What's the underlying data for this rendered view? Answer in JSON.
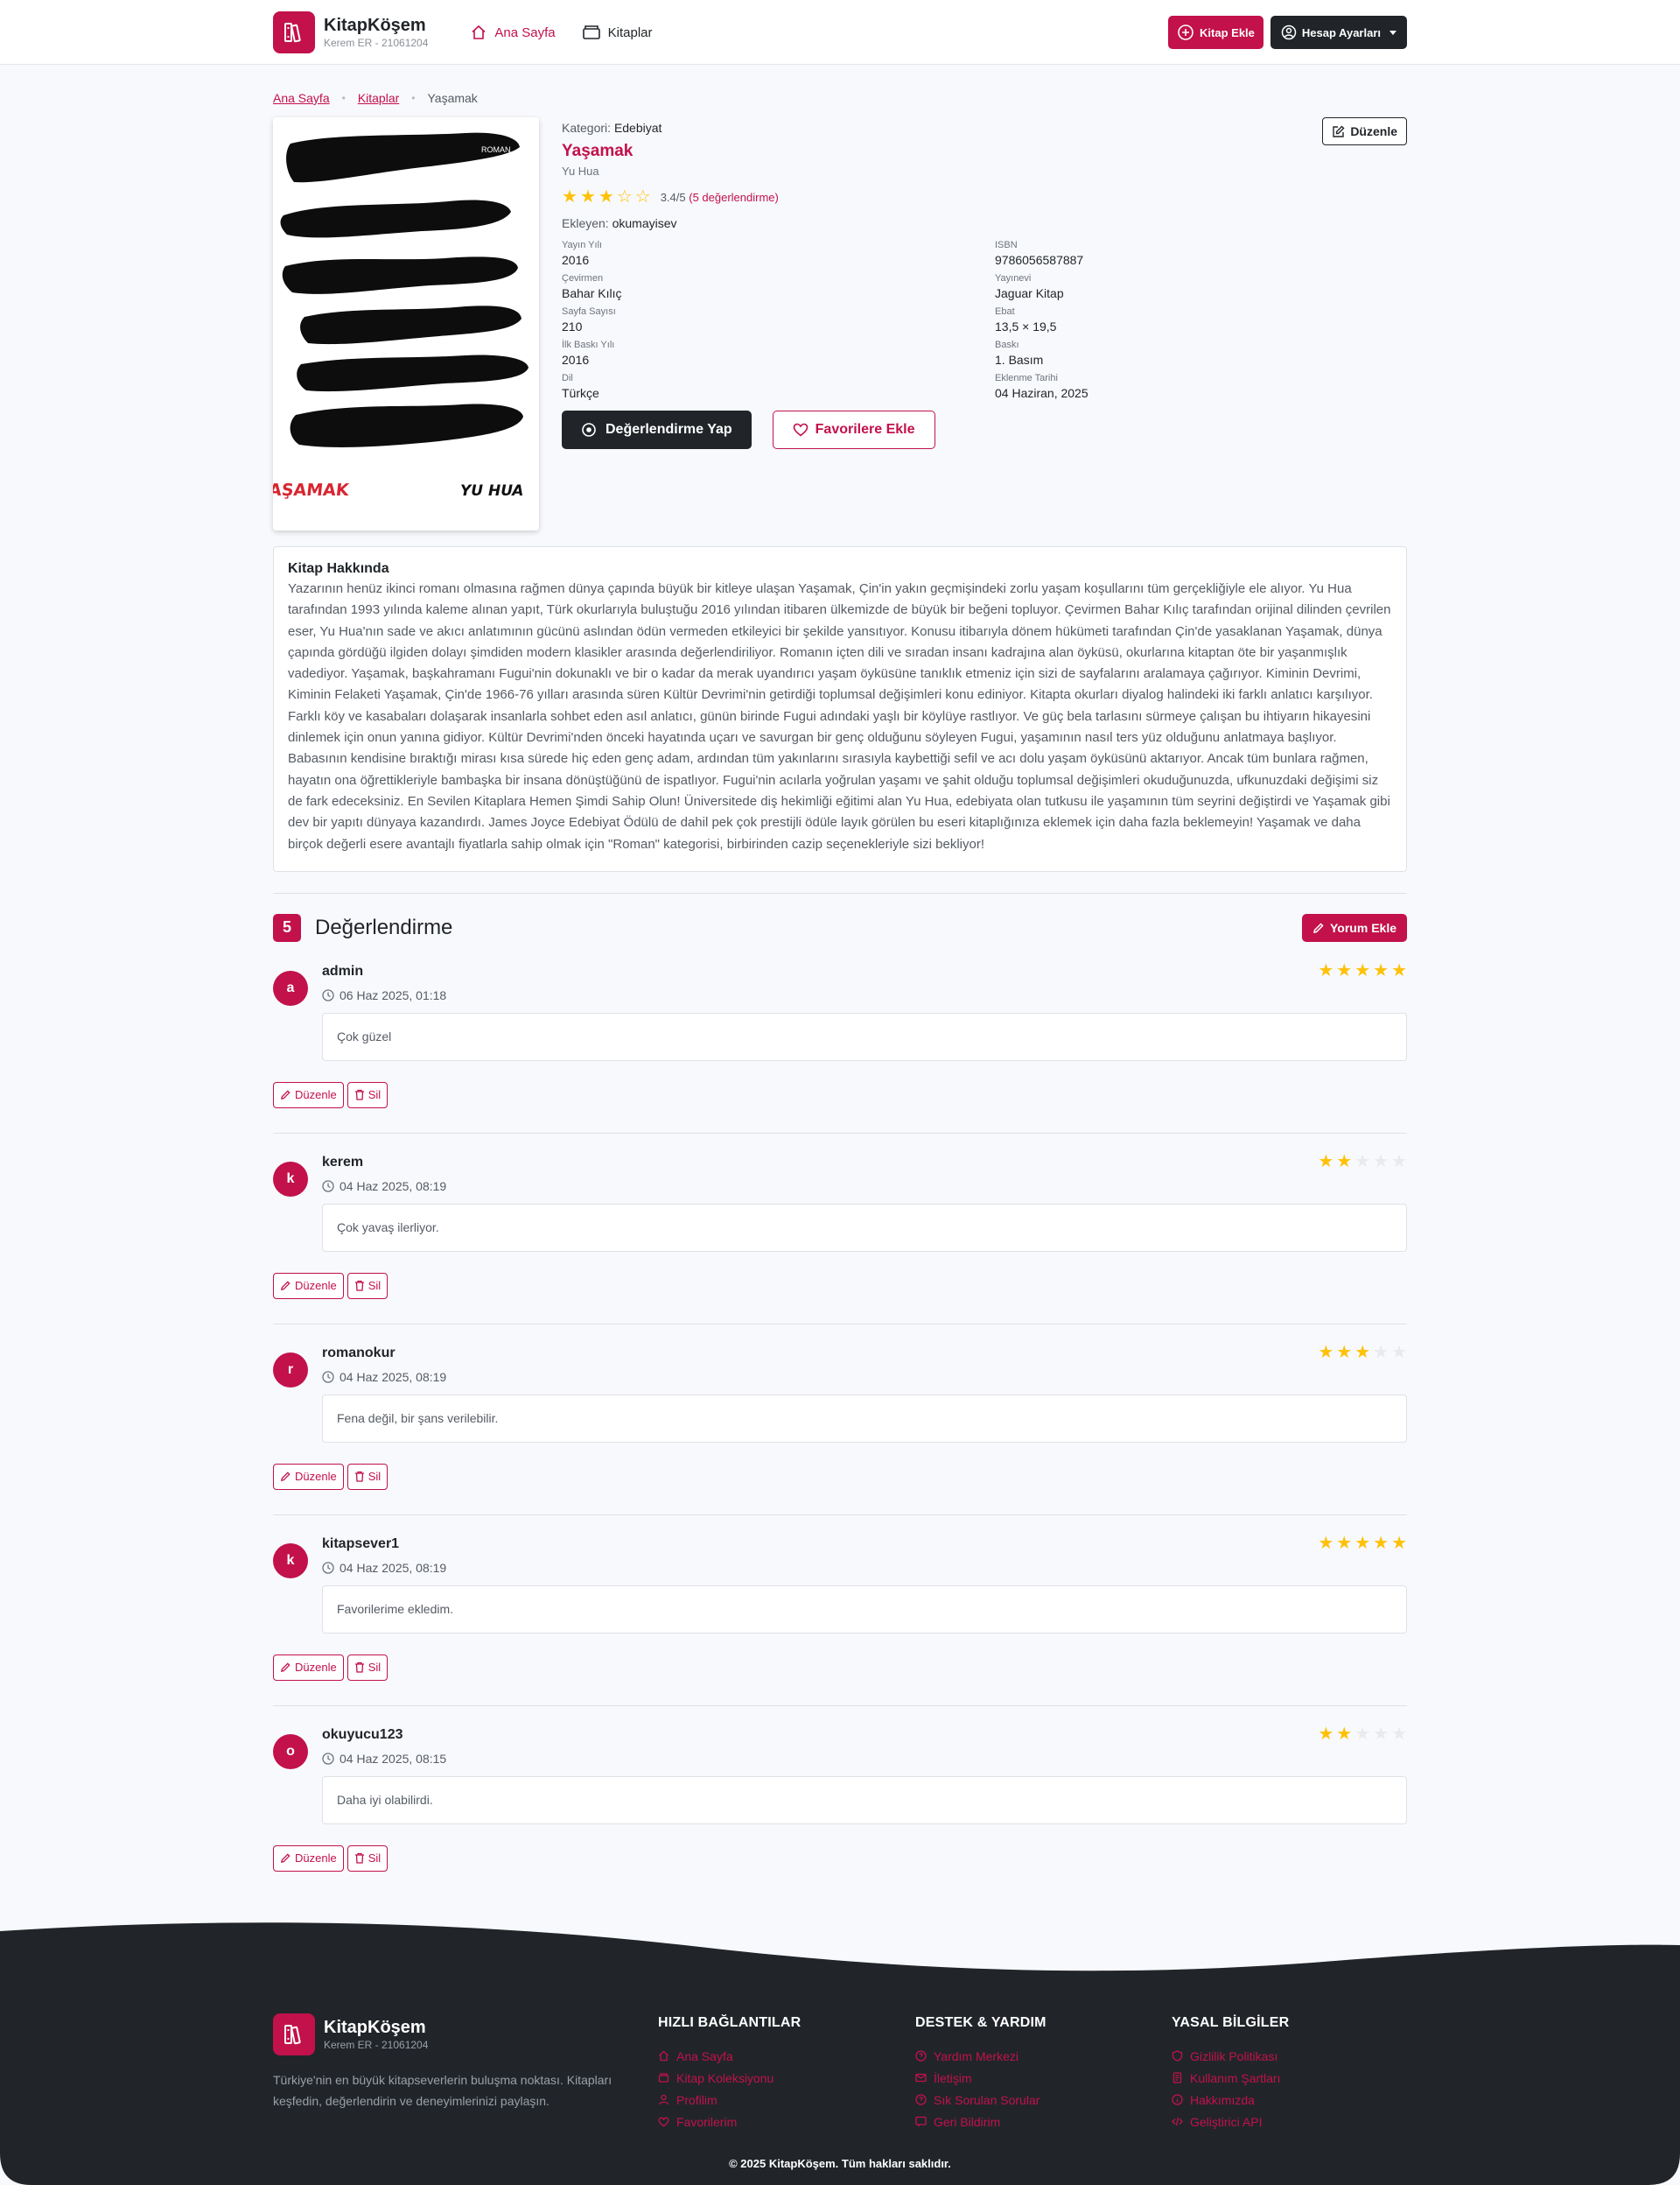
{
  "colors": {
    "accent": "#c2114b",
    "dark": "#212529",
    "star": "#ffc107"
  },
  "header": {
    "brand_name": "KitapKöşem",
    "brand_sub": "Kerem ER - 21061204",
    "nav_home": "Ana Sayfa",
    "nav_books": "Kitaplar",
    "add_book": "Kitap Ekle",
    "account": "Hesap Ayarları"
  },
  "breadcrumb": {
    "home": "Ana Sayfa",
    "books": "Kitaplar",
    "current": "Yaşamak"
  },
  "book": {
    "category_label": "Kategori:",
    "category": "Edebiyat",
    "title": "Yaşamak",
    "author": "Yu Hua",
    "rating": 3.4,
    "rating_text": "3.4/5",
    "rating_count": "(5 değerlendirme)",
    "added_by_label": "Ekleyen:",
    "added_by": "okumayisev",
    "edit_button": "Düzenle",
    "cover_title": "YAŞAMAK",
    "cover_author": "YU HUA",
    "cover_tag": "ROMAN",
    "details_left": [
      {
        "label": "Yayın Yılı",
        "value": "2016"
      },
      {
        "label": "Çevirmen",
        "value": "Bahar Kılıç"
      },
      {
        "label": "Sayfa Sayısı",
        "value": "210"
      },
      {
        "label": "İlk Baskı Yılı",
        "value": "2016"
      },
      {
        "label": "Dil",
        "value": "Türkçe"
      }
    ],
    "details_right": [
      {
        "label": "ISBN",
        "value": "9786056587887"
      },
      {
        "label": "Yayınevi",
        "value": "Jaguar Kitap"
      },
      {
        "label": "Ebat",
        "value": "13,5 × 19,5"
      },
      {
        "label": "Baskı",
        "value": "1. Basım"
      },
      {
        "label": "Eklenme Tarihi",
        "value": "04 Haziran, 2025"
      }
    ],
    "rate_button": "Değerlendirme Yap",
    "fav_button": "Favorilere Ekle"
  },
  "about": {
    "heading": "Kitap Hakkında",
    "text": "Yazarının henüz ikinci romanı olmasına rağmen dünya çapında büyük bir kitleye ulaşan Yaşamak, Çin'in yakın geçmişindeki zorlu yaşam koşullarını tüm gerçekliğiyle ele alıyor. Yu Hua tarafından 1993 yılında kaleme alınan yapıt, Türk okurlarıyla buluştuğu 2016 yılından itibaren ülkemizde de büyük bir beğeni topluyor. Çevirmen Bahar Kılıç tarafından orijinal dilinden çevrilen eser, Yu Hua'nın sade ve akıcı anlatımının gücünü aslından ödün vermeden etkileyici bir şekilde yansıtıyor. Konusu itibarıyla dönem hükümeti tarafından Çin'de yasaklanan Yaşamak, dünya çapında gördüğü ilgiden dolayı şimdiden modern klasikler arasında değerlendiriliyor. Romanın içten dili ve sıradan insanı kadrajına alan öyküsü, okurlarına kitaptan öte bir yaşanmışlık vadediyor. Yaşamak, başkahramanı Fugui'nin dokunaklı ve bir o kadar da merak uyandırıcı yaşam öyküsüne tanıklık etmeniz için sizi de sayfalarını aralamaya çağırıyor. Kiminin Devrimi, Kiminin Felaketi Yaşamak, Çin'de 1966-76 yılları arasında süren Kültür Devrimi'nin getirdiği toplumsal değişimleri konu ediniyor. Kitapta okurları diyalog halindeki iki farklı anlatıcı karşılıyor. Farklı köy ve kasabaları dolaşarak insanlarla sohbet eden asıl anlatıcı, günün birinde Fugui adındaki yaşlı bir köylüye rastlıyor. Ve güç bela tarlasını sürmeye çalışan bu ihtiyarın hikayesini dinlemek için onun yanına gidiyor. Kültür Devrimi'nden önceki hayatında uçarı ve savurgan bir genç olduğunu söyleyen Fugui, yaşamının nasıl ters yüz olduğunu anlatmaya başlıyor. Babasının kendisine bıraktığı mirası kısa sürede hiç eden genç adam, ardından tüm yakınlarını sırasıyla kaybettiği sefil ve acı dolu yaşam öyküsünü aktarıyor. Ancak tüm bunlara rağmen, hayatın ona öğrettikleriyle bambaşka bir insana dönüştüğünü de ispatlıyor. Fugui'nin acılarla yoğrulan yaşamı ve şahit olduğu toplumsal değişimleri okuduğunuzda, ufkunuzdaki değişimi siz de fark edeceksiniz. En Sevilen Kitaplara Hemen Şimdi Sahip Olun! Üniversitede diş hekimliği eğitimi alan Yu Hua, edebiyata olan tutkusu ile yaşamının tüm seyrini değiştirdi ve Yaşamak gibi dev bir yapıtı dünyaya kazandırdı. James Joyce Edebiyat Ödülü de dahil pek çok prestijli ödüle layık görülen bu eseri kitaplığınıza eklemek için daha fazla beklemeyin! Yaşamak ve daha birçok değerli esere avantajlı fiyatlarla sahip olmak için \"Roman\" kategorisi, birbirinden cazip seçenekleriyle sizi bekliyor!"
  },
  "reviews": {
    "count": "5",
    "heading": "Değerlendirme",
    "add_button": "Yorum Ekle",
    "edit_label": "Düzenle",
    "delete_label": "Sil",
    "items": [
      {
        "initial": "a",
        "user": "admin",
        "date": "06 Haz 2025, 01:18",
        "stars": 5,
        "comment": "Çok güzel"
      },
      {
        "initial": "k",
        "user": "kerem",
        "date": "04 Haz 2025, 08:19",
        "stars": 2,
        "comment": "Çok yavaş ilerliyor."
      },
      {
        "initial": "r",
        "user": "romanokur",
        "date": "04 Haz 2025, 08:19",
        "stars": 3,
        "comment": "Fena değil, bir şans verilebilir."
      },
      {
        "initial": "k",
        "user": "kitapsever1",
        "date": "04 Haz 2025, 08:19",
        "stars": 5,
        "comment": "Favorilerime ekledim."
      },
      {
        "initial": "o",
        "user": "okuyucu123",
        "date": "04 Haz 2025, 08:15",
        "stars": 2,
        "comment": "Daha iyi olabilirdi."
      }
    ]
  },
  "footer": {
    "brand_name": "KitapKöşem",
    "brand_sub": "Kerem ER - 21061204",
    "description": "Türkiye'nin en büyük kitapseverlerin buluşma noktası. Kitapları keşfedin, değerlendirin ve deneyimlerinizi paylaşın.",
    "quick_links_title": "HIZLI BAĞLANTILAR",
    "quick_links": [
      "Ana Sayfa",
      "Kitap Koleksiyonu",
      "Profilim",
      "Favorilerim"
    ],
    "support_title": "DESTEK & YARDIM",
    "support_links": [
      "Yardım Merkezi",
      "İletişim",
      "Sık Sorulan Sorular",
      "Geri Bildirim"
    ],
    "legal_title": "YASAL BİLGİLER",
    "legal_links": [
      "Gizlilik Politikası",
      "Kullanım Şartları",
      "Hakkımızda",
      "Geliştirici API"
    ],
    "copyright": "© 2025 KitapKöşem. Tüm hakları saklıdır."
  }
}
